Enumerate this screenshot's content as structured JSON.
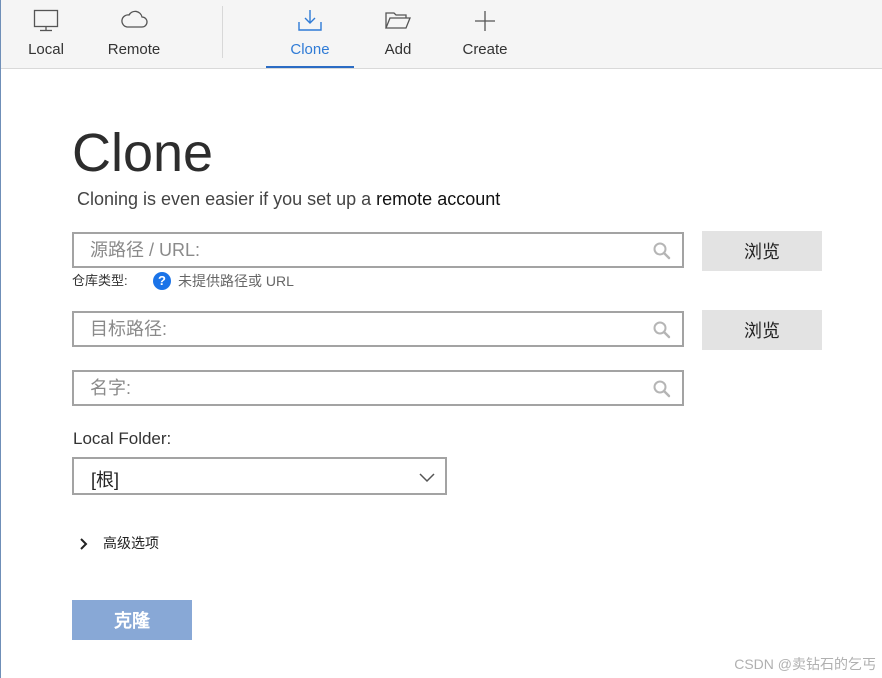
{
  "toolbar": {
    "local": "Local",
    "remote": "Remote",
    "clone": "Clone",
    "add": "Add",
    "create": "Create"
  },
  "page": {
    "title": "Clone",
    "subtitle": "Cloning is even easier if you set up a ",
    "subtitle_link": "remote account"
  },
  "source": {
    "placeholder": "源路径 / URL:",
    "browse": "浏览"
  },
  "repo_type": {
    "label": "仓库类型:",
    "help": "?",
    "value": "未提供路径或 URL"
  },
  "destination": {
    "placeholder": "目标路径:",
    "browse": "浏览"
  },
  "name_field": {
    "placeholder": "名字:"
  },
  "local_folder": {
    "label": "Local Folder:",
    "value": "[根]"
  },
  "advanced": {
    "label": "高级选项"
  },
  "clone_button": "克隆",
  "watermark": "CSDN @卖钻石的乞丐",
  "colors": {
    "accent": "#2f7bd6",
    "clone_button": "#88a8d6",
    "browse_button": "#e3e3e3",
    "help_icon": "#1a73e8"
  }
}
